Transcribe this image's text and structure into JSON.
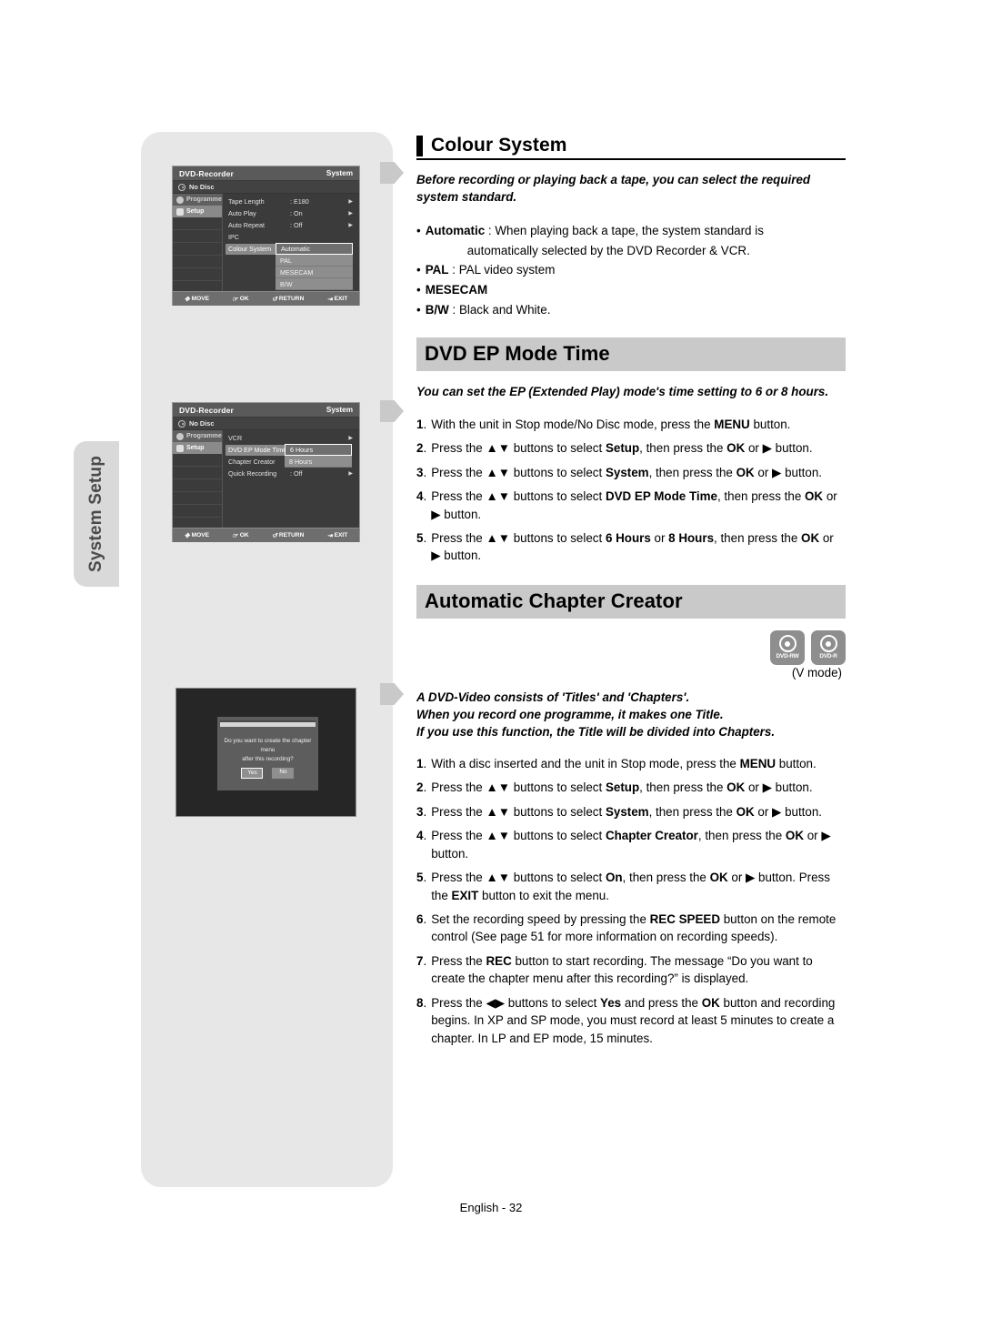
{
  "side_tab": {
    "label": "System Setup"
  },
  "footer": {
    "text": "English - 32"
  },
  "sections": {
    "colour_system": {
      "heading": "Colour System",
      "intro": "Before recording or playing back a tape, you can select the required system standard.",
      "bullets": [
        {
          "term": "Automatic",
          "sep": ":",
          "desc": "When playing back a tape, the system standard is",
          "cont": "automatically selected by the DVD Recorder & VCR."
        },
        {
          "term": "PAL",
          "sep": ":",
          "desc": "PAL video system",
          "cont": ""
        },
        {
          "term": "MESECAM",
          "sep": "",
          "desc": "",
          "cont": ""
        },
        {
          "term": "B/W",
          "sep": ":",
          "desc": "Black and White.",
          "cont": ""
        }
      ]
    },
    "dvd_ep_mode_time": {
      "heading": "DVD EP Mode Time",
      "intro": "You can set the EP (Extended Play) mode's time setting to 6 or 8 hours.",
      "steps": [
        {
          "n": "1",
          "parts": [
            {
              "t": "With the unit in Stop mode/No Disc mode, press the "
            },
            {
              "t": "MENU",
              "b": true
            },
            {
              "t": " button."
            }
          ]
        },
        {
          "n": "2",
          "parts": [
            {
              "t": "Press the ▲▼ buttons to select "
            },
            {
              "t": "Setup",
              "b": true
            },
            {
              "t": ", then press the "
            },
            {
              "t": "OK",
              "b": true
            },
            {
              "t": " or ▶ button."
            }
          ]
        },
        {
          "n": "3",
          "parts": [
            {
              "t": "Press the ▲▼ buttons to select "
            },
            {
              "t": "System",
              "b": true
            },
            {
              "t": ", then press the "
            },
            {
              "t": "OK",
              "b": true
            },
            {
              "t": " or ▶ button."
            }
          ]
        },
        {
          "n": "4",
          "parts": [
            {
              "t": "Press the ▲▼ buttons to select "
            },
            {
              "t": "DVD EP Mode Time",
              "b": true
            },
            {
              "t": ", then press the "
            },
            {
              "t": "OK",
              "b": true
            },
            {
              "t": " or ▶ button."
            }
          ]
        },
        {
          "n": "5",
          "parts": [
            {
              "t": "Press the ▲▼ buttons to select "
            },
            {
              "t": "6 Hours",
              "b": true
            },
            {
              "t": " or "
            },
            {
              "t": "8 Hours",
              "b": true
            },
            {
              "t": ", then press the "
            },
            {
              "t": "OK",
              "b": true
            },
            {
              "t": " or ▶ button."
            }
          ]
        }
      ]
    },
    "automatic_chapter_creator": {
      "heading": "Automatic Chapter Creator",
      "disc_badges": [
        {
          "label": "DVD-RW",
          "icon": "disc-icon"
        },
        {
          "label": "DVD-R",
          "icon": "disc-icon"
        }
      ],
      "mode_note": "(V mode)",
      "intro_lines": [
        "A DVD-Video consists of 'Titles' and 'Chapters'.",
        "When you record one programme, it makes one Title.",
        "If you use this function, the Title will be divided into Chapters."
      ],
      "steps": [
        {
          "n": "1",
          "parts": [
            {
              "t": "With a disc inserted and the unit in Stop mode, press the "
            },
            {
              "t": "MENU",
              "b": true
            },
            {
              "t": " button."
            }
          ]
        },
        {
          "n": "2",
          "parts": [
            {
              "t": "Press the ▲▼ buttons to select "
            },
            {
              "t": "Setup",
              "b": true
            },
            {
              "t": ", then press the "
            },
            {
              "t": "OK",
              "b": true
            },
            {
              "t": " or ▶ button."
            }
          ]
        },
        {
          "n": "3",
          "parts": [
            {
              "t": "Press the ▲▼ buttons to select "
            },
            {
              "t": "System",
              "b": true
            },
            {
              "t": ", then press the "
            },
            {
              "t": "OK",
              "b": true
            },
            {
              "t": " or ▶ button."
            }
          ]
        },
        {
          "n": "4",
          "parts": [
            {
              "t": "Press the ▲▼ buttons to select "
            },
            {
              "t": "Chapter Creator",
              "b": true
            },
            {
              "t": ", then press the "
            },
            {
              "t": "OK",
              "b": true
            },
            {
              "t": " or ▶ button."
            }
          ]
        },
        {
          "n": "5",
          "parts": [
            {
              "t": "Press the ▲▼ buttons to select "
            },
            {
              "t": "On",
              "b": true
            },
            {
              "t": ", then press the "
            },
            {
              "t": "OK",
              "b": true
            },
            {
              "t": " or ▶ button. Press the "
            },
            {
              "t": "EXIT",
              "b": true
            },
            {
              "t": " button to exit the menu."
            }
          ]
        },
        {
          "n": "6",
          "parts": [
            {
              "t": "Set the recording speed by pressing the "
            },
            {
              "t": "REC SPEED",
              "b": true
            },
            {
              "t": " button on the remote control (See page 51 for more information on recording speeds)."
            }
          ]
        },
        {
          "n": "7",
          "parts": [
            {
              "t": "Press the "
            },
            {
              "t": "REC",
              "b": true
            },
            {
              "t": " button to start recording. The message “Do you want to create the chapter menu after this recording?” is displayed."
            }
          ]
        },
        {
          "n": "8",
          "parts": [
            {
              "t": "Press the ◀▶ buttons to select "
            },
            {
              "t": "Yes",
              "b": true
            },
            {
              "t": " and press the "
            },
            {
              "t": "OK",
              "b": true
            },
            {
              "t": " button and recording begins. In XP and SP mode, you must record at least 5 minutes to create a chapter. In LP and EP mode, 15 minutes."
            }
          ]
        }
      ]
    }
  },
  "osd_colour_system": {
    "brand": "DVD-Recorder",
    "section": "System",
    "status": "No Disc",
    "nav": [
      {
        "label": "Programme",
        "icon": "programme-icon",
        "state": "normal"
      },
      {
        "label": "Setup",
        "icon": "gear-icon",
        "state": "selected"
      }
    ],
    "rows": [
      {
        "label": "Tape Length",
        "value": ": E180",
        "arrow": "▶",
        "selected": false
      },
      {
        "label": "Auto Play",
        "value": ": On",
        "arrow": "▶",
        "selected": false
      },
      {
        "label": "Auto Repeat",
        "value": ": Off",
        "arrow": "▶",
        "selected": false
      },
      {
        "label": "IPC",
        "value": "",
        "arrow": "",
        "selected": false
      },
      {
        "label": "Colour System",
        "value": "",
        "arrow": "",
        "selected": true
      }
    ],
    "popup": [
      {
        "label": "Automatic",
        "highlighted": true
      },
      {
        "label": "PAL",
        "highlighted": false
      },
      {
        "label": "MESECAM",
        "highlighted": false
      },
      {
        "label": "B/W",
        "highlighted": false
      }
    ],
    "footer": [
      {
        "icon": "dpad-icon",
        "label": "MOVE"
      },
      {
        "icon": "ok-icon",
        "label": "OK"
      },
      {
        "icon": "return-icon",
        "label": "RETURN"
      },
      {
        "icon": "exit-icon",
        "label": "EXIT"
      }
    ]
  },
  "osd_ep_mode": {
    "brand": "DVD-Recorder",
    "section": "System",
    "status": "No Disc",
    "nav": [
      {
        "label": "Programme",
        "icon": "programme-icon",
        "state": "normal"
      },
      {
        "label": "Setup",
        "icon": "gear-icon",
        "state": "selected"
      }
    ],
    "rows": [
      {
        "label": "VCR",
        "value": "",
        "arrow": "▶",
        "selected": false
      },
      {
        "label": "DVD EP Mode Time",
        "value": "",
        "arrow": "",
        "selected": true
      },
      {
        "label": "Chapter Creator",
        "value": "",
        "arrow": "",
        "selected": false
      },
      {
        "label": "Quick Recording",
        "value": ": Off",
        "arrow": "▶",
        "selected": false
      }
    ],
    "popup": [
      {
        "label": "6 Hours",
        "highlighted": true
      },
      {
        "label": "8 Hours",
        "highlighted": false
      }
    ],
    "footer": [
      {
        "icon": "dpad-icon",
        "label": "MOVE"
      },
      {
        "icon": "ok-icon",
        "label": "OK"
      },
      {
        "icon": "return-icon",
        "label": "RETURN"
      },
      {
        "icon": "exit-icon",
        "label": "EXIT"
      }
    ]
  },
  "osd_dialog": {
    "message_line1": "Do you want to create the chapter menu",
    "message_line2": "after this recording?",
    "buttons": [
      {
        "label": "Yes",
        "selected": true
      },
      {
        "label": "No",
        "selected": false
      }
    ]
  }
}
